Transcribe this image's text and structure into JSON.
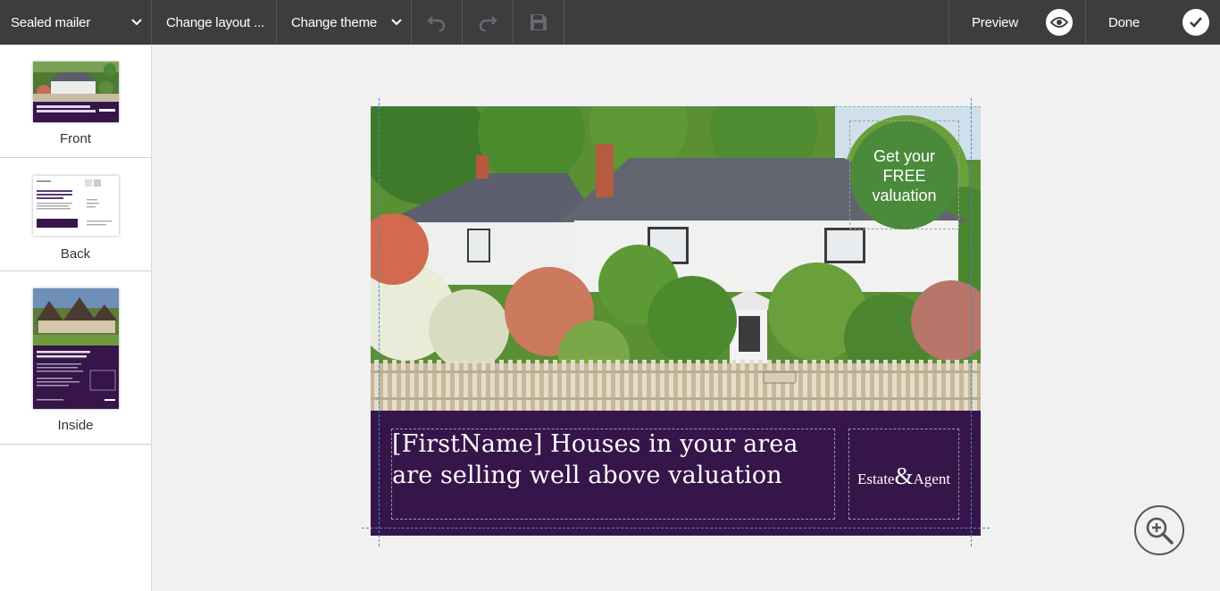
{
  "toolbar": {
    "document_name": "Sealed mailer",
    "change_layout": "Change layout ...",
    "change_theme": "Change theme",
    "preview": "Preview",
    "done": "Done"
  },
  "sidebar": {
    "pages": [
      {
        "label": "Front"
      },
      {
        "label": "Back"
      },
      {
        "label": "Inside"
      }
    ]
  },
  "mailer": {
    "badge_line1": "Get your",
    "badge_line2": "FREE",
    "badge_line3": "valuation",
    "headline": "[FirstName] Houses in your area are selling well above valuation",
    "logo_word1": "Estate",
    "logo_amp": "&",
    "logo_word2": "Agent"
  },
  "thumbs": {
    "front_caption": "[FirstName] Houses in your area are selling well above valuation",
    "back_title": "Now you know your property's true value, it's the time to sell",
    "inside_title": "How do you like the sound of a £50,000 sale profit to spend?"
  },
  "colors": {
    "toolbar": "#3d3d40",
    "band_purple": "#36154a",
    "badge_green": "#4a8a3a"
  }
}
